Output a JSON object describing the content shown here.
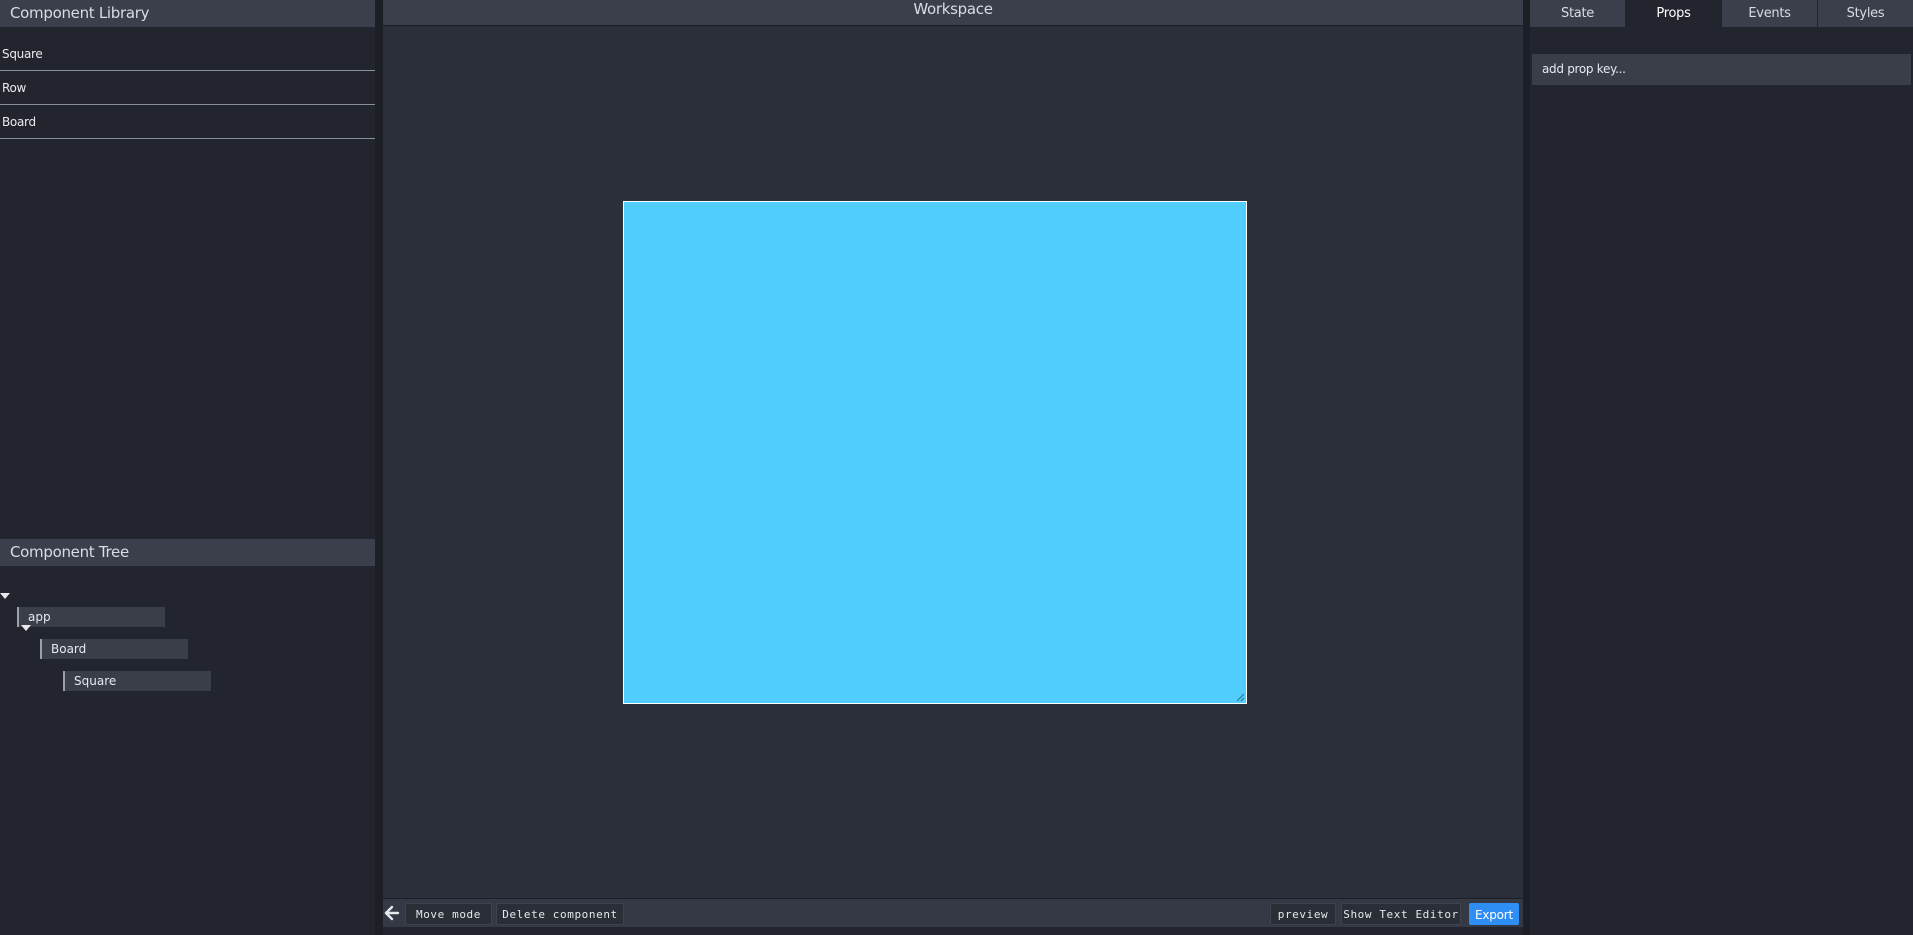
{
  "left": {
    "library_title": "Component Library",
    "library_items": [
      {
        "label": "Square"
      },
      {
        "label": "Row"
      },
      {
        "label": "Board"
      }
    ],
    "tree_title": "Component Tree",
    "tree_nodes": [
      {
        "label": "app",
        "expanded": true
      },
      {
        "label": "Board",
        "expanded": true
      },
      {
        "label": "Square",
        "expanded": false
      }
    ]
  },
  "workspace": {
    "title": "Workspace",
    "canvas_color": "#51cefe",
    "toolbar": {
      "move_mode": "Move mode",
      "delete_component": "Delete component",
      "preview": "preview",
      "show_text_editor": "Show Text Editor",
      "export": "Export"
    }
  },
  "right": {
    "tabs": [
      {
        "label": "State",
        "active": false
      },
      {
        "label": "Props",
        "active": true
      },
      {
        "label": "Events",
        "active": false
      },
      {
        "label": "Styles",
        "active": false
      }
    ],
    "prop_input_placeholder": "add prop key..."
  },
  "colors": {
    "accent": "#2f8ef4",
    "panel_bg": "#22252e",
    "header_bg": "#3b3f4b"
  }
}
